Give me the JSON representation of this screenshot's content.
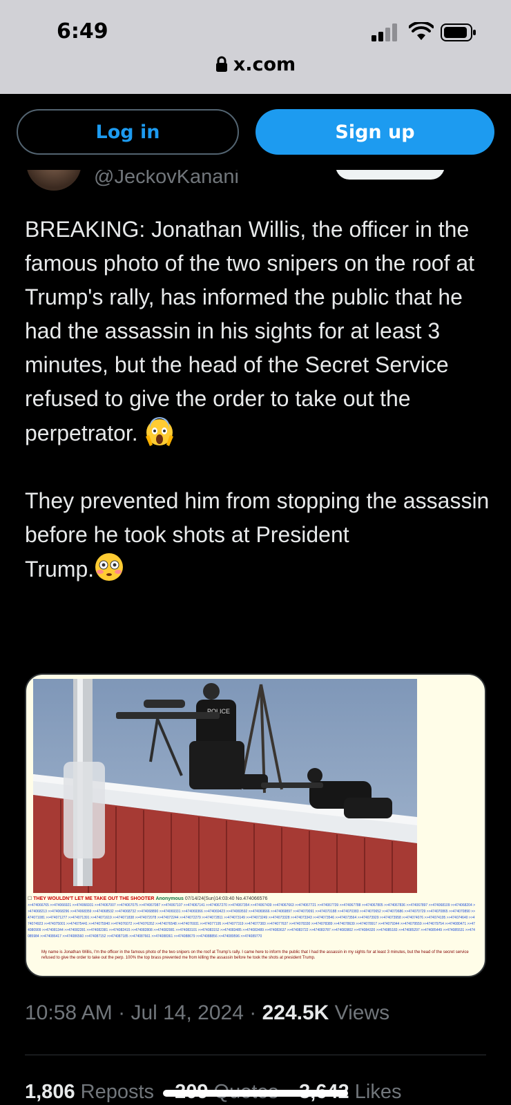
{
  "status_bar": {
    "time": "6:49"
  },
  "browser": {
    "url": "x.com"
  },
  "auth": {
    "login_label": "Log in",
    "signup_label": "Sign up"
  },
  "author": {
    "handle": "@JeckovKanani"
  },
  "tweet": {
    "text": "BREAKING: Jonathan Willis, the officer in the famous photo of the two snipers on the roof at Trump's rally, has informed the public that he had the assassin in his sights for at least 3 minutes, but the head of the Secret Service refused to give the order to take out the perpetrator. ",
    "text2": "They prevented him from stopping the assassin before he took shots at President\nTrump.",
    "emoji1": "face-screaming-in-fear",
    "emoji2": "flushed-face"
  },
  "media": {
    "vest_text": "POLICE",
    "post_title": "THEY WOULDN'T LET ME TAKE OUT THE SHOOTER",
    "post_author": "Anonymous",
    "post_meta": "07/14/24(Sun)14:03:40 No.474066576",
    "replies": ">>474066765 >>474066921 >>474066931 >>474067007 >>474067075 >>474067087 >>474067107 >>474067141 >>474067270 >>474067354 >>474067439 >>474067663 >>474067721 >>474067739 >>474067788 >>474067805 >>474067836 >>474067897 >>474068109 >>474068204 >>474068213 >>474068296 >>474068359 >>474068532 >>474068732 >>474068890 >>474069331 >>474069366 >>474069423 >>474069592 >>474069666 >>474069897 >>474070091 >>474070188 >>474070383 >>474070652 >>474070686 >>474070729 >>474070865 >>474070890 >>474071081 >>474071277 >>474071391 >>474071619 >>474071838 >>474072078 >>474072244 >>474072279 >>474072811 >>474073149 >>474073249 >>474073328 >>474073343 >>474073546 >>474073564 >>474073929 >>474073958 >>474074076 >>474074195 >>474074640 >>474074923 >>474075001 >>474075441 >>474075940 >>474076072 >>474076352 >>474076548 >>474076931 >>474077195 >>474077319 >>474077383 >>474077637 >>474078330 >>474078389 >>474078639 >>474078917 >>474079344 >>474079559 >>474079754 >>474080471 >>474080909 >>474081344 >>474082281 >>474082381 >>474082415 >>474082808 >>474082981 >>474083101 >>474083152 >>474083485 >>474083489 >>474083637 >>474083722 >>474083787 >>474083802 >>474084320 >>474085183 >>474085297 >>474085449 >>474085531 >>474085984 >>474086417 >>474086560 >>474087152 >>474087185 >>474087661 >>474088361 >>474088679 >>474088856 >>474089596 >>474089770",
    "post_body": "My name is Jonathan Willis, I'm the officer in the famous photo of the two snipers on the roof at Trump's rally. I came here to inform the public that I had the assassin in my sights for at least 3 minutes, but the head of the secret service refused to give the order to take out the perp. 100% the top brass prevented me from killing the assassin before he took the shots at president Trump."
  },
  "meta": {
    "time": "10:58 AM",
    "date": "Jul 14, 2024",
    "views_count": "224.5K",
    "views_label": "Views"
  },
  "stats": {
    "reposts_count": "1,806",
    "reposts_label": "Reposts",
    "quotes_count": "209",
    "quotes_label": "Quotes",
    "likes_count": "3,642",
    "likes_label": "Likes"
  },
  "colors": {
    "accent": "#1d9bf0",
    "background": "#000000",
    "muted": "#71767b"
  }
}
